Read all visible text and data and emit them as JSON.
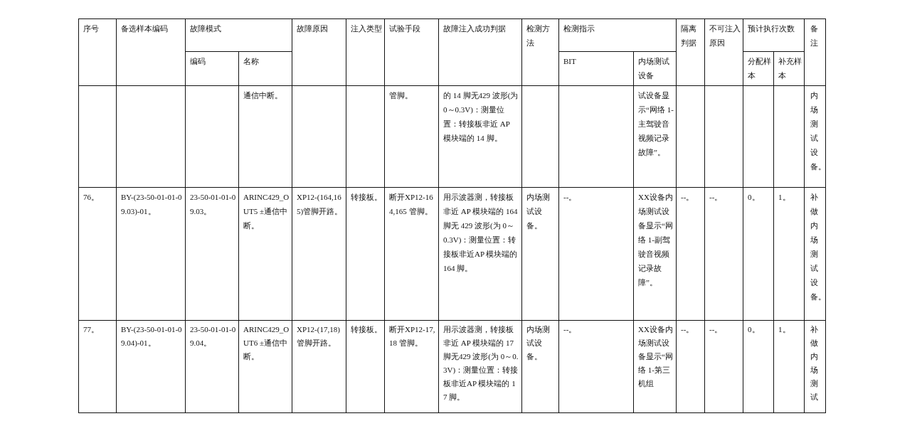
{
  "header": {
    "no": "序号",
    "sample_code": "备选样本编码",
    "fault_mode": {
      "label": "故障模式",
      "code": "编码",
      "name": "名称"
    },
    "cause": "故障原因",
    "injection_type": "注入类型",
    "test_method": "试验手段",
    "success_criterion": "故障注入成功判据",
    "detection_method": "检测方法",
    "detection_indication": {
      "label": "检测指示",
      "bit": "BIT",
      "test_equipment": "内场测试设备"
    },
    "isolation": "隔离判据",
    "reason_not_injectable": "不可注入原因",
    "planned_runs": {
      "label": "预计执行次数",
      "allocated": "分配样本",
      "supplementary": "补充样本"
    },
    "remarks": "备注"
  },
  "rows": [
    {
      "mode_name": "通信中断。",
      "test_method": "管脚。",
      "success_criterion": "的 14 脚无429 波形(为 0～0.3V)：测量位置：转接板非近 AP 模块端的 14 脚。",
      "test_equipment": "试设备显示“网络 1-主驾驶音视频记录故障”。",
      "remarks": "内场测试设备。"
    },
    {
      "no": "76。",
      "sample_code": "BY-(23-50-01-01-09.03)-01。",
      "mode_code": "23-50-01-01-09.03。",
      "mode_name": "ARINC429_OUT5 ±通信中断。",
      "cause": "XP12-(164,165)管脚开路。",
      "injection_type": "转接板。",
      "test_method": "断开XP12-164,165 管脚。",
      "success_criterion": "用示波器测，转接板非近 AP 模块端的 164 脚无 429 波形(为 0～0.3V)：测量位置：转接板非近AP 模块端的164 脚。",
      "detection_method": "内场测试设备。",
      "bit": "--。",
      "test_equipment": "XX设备内场测试设备显示“网络 1-副驾驶音视频记录故障”。",
      "isolation": "--。",
      "reason_not_injectable": "--。",
      "allocated": "0。",
      "supplementary": "1。",
      "remarks": "补做内场测试设备。"
    },
    {
      "no": "77。",
      "sample_code": "BY-(23-50-01-01-09.04)-01。",
      "mode_code": "23-50-01-01-09.04。",
      "mode_name": "ARINC429_OUT6 ±通信中断。",
      "cause": "XP12-(17,18)管脚开路。",
      "injection_type": "转接板。",
      "test_method": "断开XP12-17,18 管脚。",
      "success_criterion": "用示波器测，转接板非近 AP 模块端的 17 脚无429 波形(为 0～0.3V)：测量位置：转接板非近AP 模块端的 17 脚。",
      "detection_method": "内场测试设备。",
      "bit": "--。",
      "test_equipment": "XX设备内场测试设备显示“网络 1-第三机组",
      "isolation": "--。",
      "reason_not_injectable": "--。",
      "allocated": "0。",
      "supplementary": "1。",
      "remarks": "补做内场测试"
    }
  ]
}
